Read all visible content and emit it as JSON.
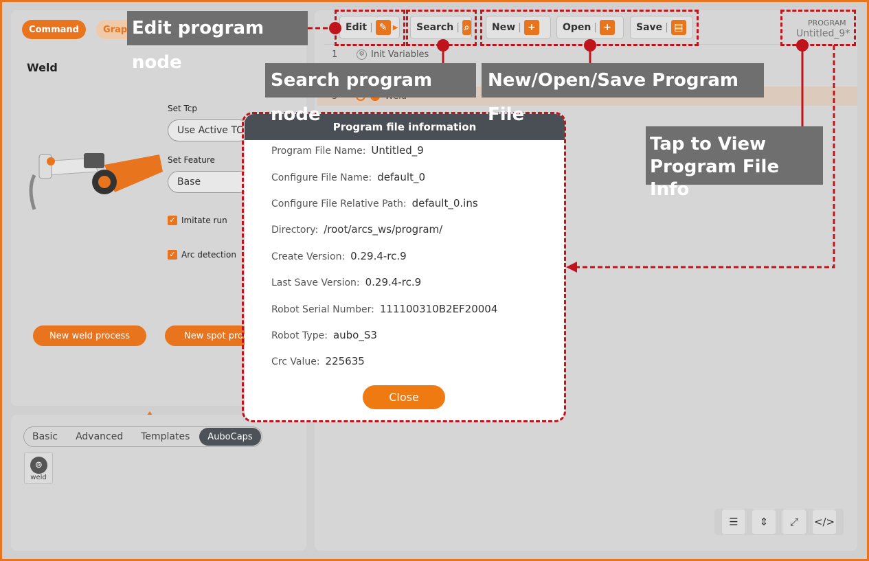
{
  "left": {
    "command_tab": "Command",
    "graph_tab": "Grap",
    "title": "Weld",
    "set_tcp_label": "Set Tcp",
    "set_tcp_value": "Use Active TC",
    "set_feature_label": "Set Feature",
    "set_feature_value": "Base",
    "imitate_run": "Imitate run",
    "arc_detection": "Arc detection",
    "new_weld_process": "New weld process",
    "new_spot_process": "New spot proc"
  },
  "palette": {
    "tabs": [
      "Basic",
      "Advanced",
      "Templates"
    ],
    "active_tab": "AuboCaps",
    "item": "weld"
  },
  "toolbar": {
    "edit": "Edit",
    "search": "Search",
    "new": "New",
    "open": "Open",
    "save": "Save",
    "program_label": "PROGRAM",
    "program_name": "Untitled_9*"
  },
  "tree": {
    "row1_num": "1",
    "row1_text": "Init Variables",
    "row3_num": "3",
    "row3_text": "Weld"
  },
  "modal": {
    "title": "Program file information",
    "fields": [
      {
        "key": "Program File Name:",
        "value": "Untitled_9"
      },
      {
        "key": "Configure File Name:",
        "value": "default_0"
      },
      {
        "key": "Configure File Relative Path:",
        "value": "default_0.ins"
      },
      {
        "key": "Directory:",
        "value": "/root/arcs_ws/program/"
      },
      {
        "key": "Create Version:",
        "value": "0.29.4-rc.9"
      },
      {
        "key": "Last Save Version:",
        "value": "0.29.4-rc.9"
      },
      {
        "key": "Robot Serial Number:",
        "value": "111100310B2EF20004"
      },
      {
        "key": "Robot Type:",
        "value": "aubo_S3"
      },
      {
        "key": "Crc Value:",
        "value": "225635"
      }
    ],
    "close": "Close"
  },
  "callouts": {
    "edit_node": "Edit program node",
    "search_node": "Search program node",
    "file_ops": "New/Open/Save Program File",
    "view_info_line1": "Tap to View",
    "view_info_line2": "Program File Info"
  },
  "colors": {
    "accent": "#e8741e",
    "annotation_red": "#c0141c",
    "callout_gray": "#6f6f6f",
    "modal_header": "#4a4e55"
  }
}
